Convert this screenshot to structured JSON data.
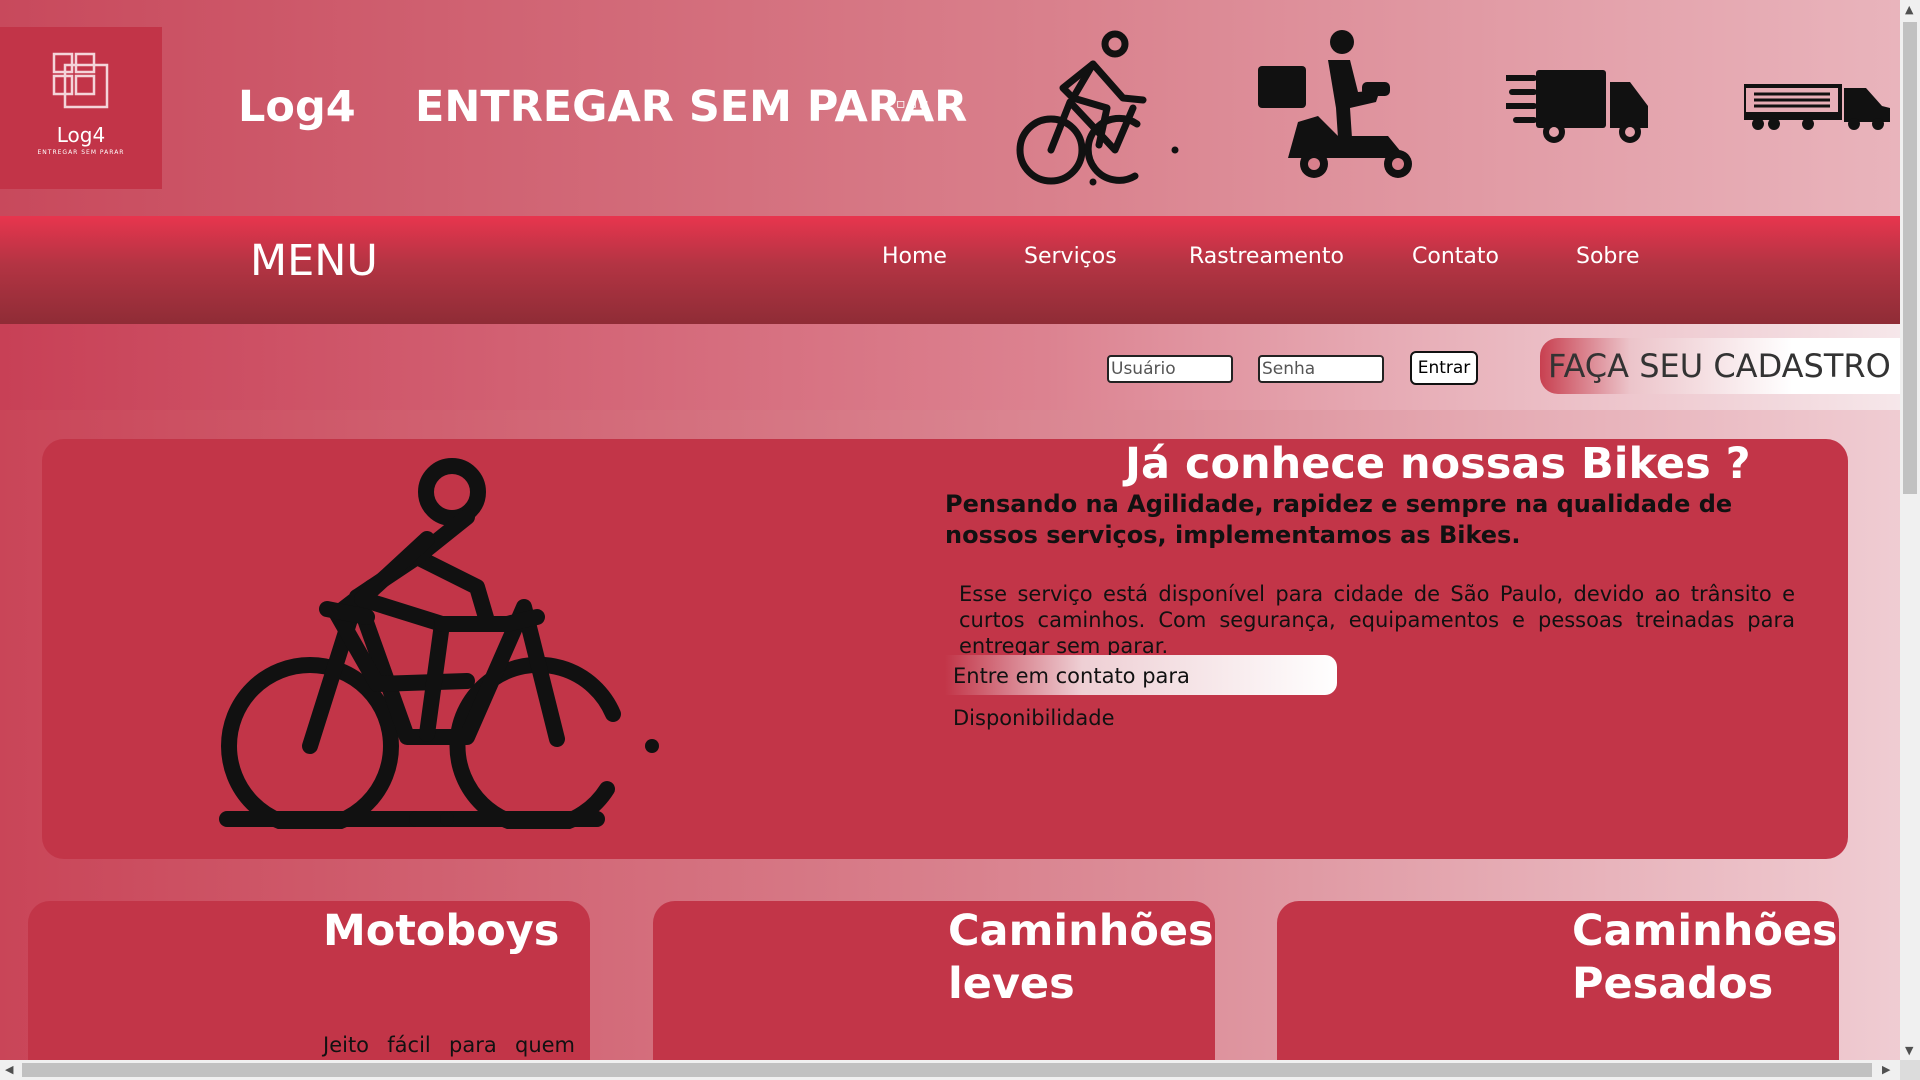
{
  "header": {
    "logo_name": "Log4",
    "logo_tagline": "ENTREGAR SEM PARAR",
    "brand": "Log4",
    "slogan": "ENTREGAR SEM PARAR",
    "slogan_dots": "▫▫▫",
    "icons": [
      "bicycle-icon",
      "scooter-delivery-icon",
      "fast-truck-icon",
      "semi-truck-icon"
    ]
  },
  "nav": {
    "menu_title": "MENU",
    "links": [
      "Home",
      "Serviços",
      "Rastreamento",
      "Contato",
      "Sobre"
    ]
  },
  "login": {
    "user_placeholder": "Usuário",
    "password_placeholder": "Senha",
    "submit_label": "Entrar",
    "signup_label": "FAÇA SEU CADASTRO"
  },
  "bikes": {
    "title": "Já conhece nossas Bikes ?",
    "subtitle": "Pensando na Agilidade, rapidez e sempre na qualidade de nossos serviços, implementamos as Bikes.",
    "description": "Esse serviço está disponível para cidade de São Paulo, devido ao trânsito e curtos caminhos. Com segurança, equipamentos e pessoas treinadas para entregar sem parar.",
    "cta": "Entre em contato para Disponibilidade"
  },
  "services": [
    {
      "title": "Motoboys",
      "text": "Jeito fácil para quem"
    },
    {
      "title": "Caminhões leves",
      "text": ""
    },
    {
      "title": "Caminhões Pesados",
      "text": ""
    }
  ],
  "colors": {
    "accent": "#c23548",
    "nav_top": "#e8354e",
    "nav_bottom": "#8f2c36"
  }
}
